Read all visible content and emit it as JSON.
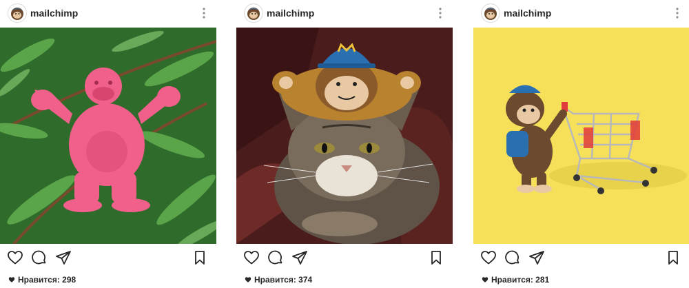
{
  "posts": [
    {
      "username": "mailchimp",
      "likes_label": "Нравится:",
      "likes_count": "298"
    },
    {
      "username": "mailchimp",
      "likes_label": "Нравится:",
      "likes_count": "374"
    },
    {
      "username": "mailchimp",
      "likes_label": "Нравится:",
      "likes_count": "281"
    }
  ],
  "icons": {
    "avatar": "freddie-logo-icon",
    "more": "more-options-icon",
    "like": "heart-outline-icon",
    "comment": "comment-icon",
    "share": "share-direct-icon",
    "save": "bookmark-icon",
    "likes": "heart-filled-icon"
  },
  "colors": {
    "text": "#262626",
    "border": "#dbdbdb",
    "photo1_bg": "#2f6b2a",
    "photo2_bg": "#4a1c1c",
    "photo3_bg": "#f6e05a"
  }
}
